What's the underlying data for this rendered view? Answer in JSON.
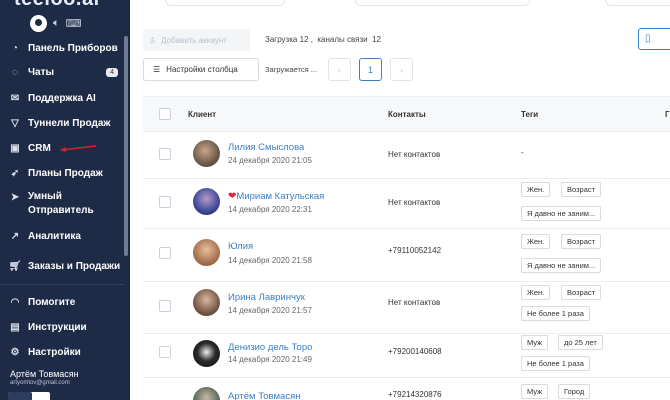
{
  "app": {
    "logo": "teeloo.ai"
  },
  "sidebar": {
    "items": [
      {
        "label": "Панель Приборов",
        "icon": "gauge-icon"
      },
      {
        "label": "Чаты",
        "icon": "chat-icon",
        "badge": "4"
      },
      {
        "label": "Поддержка AI",
        "icon": "mail-icon"
      },
      {
        "label": "Туннели Продаж",
        "icon": "filter-icon"
      },
      {
        "label": "CRM",
        "icon": "contacts-icon"
      },
      {
        "label": "Планы Продаж",
        "icon": "rocket-icon"
      },
      {
        "label": "Умный Отправитель",
        "icon": "paper-plane-icon"
      },
      {
        "label": "Аналитика",
        "icon": "chart-icon"
      },
      {
        "label": "Заказы и Продажи",
        "icon": "cart-icon"
      }
    ],
    "bottom_items": [
      {
        "label": "Помогите",
        "icon": "help-icon"
      },
      {
        "label": "Инструкции",
        "icon": "document-icon"
      },
      {
        "label": "Настройки",
        "icon": "gear-icon"
      }
    ],
    "user": {
      "name": "Артём Товмасян",
      "email": "artyomtov@gmail.com"
    }
  },
  "toolbar": {
    "add_account": "Добавить аккаунт",
    "load_status": "Загрузка 12 ,  каналы связи  12",
    "column_settings": "Настройки столбца",
    "loading": "Загружается ...",
    "page": "1",
    "prev": "‹",
    "next": "›"
  },
  "table": {
    "headers": {
      "client": "Клиент",
      "contacts": "Контакты",
      "tags": "Теги",
      "extra": "Г"
    },
    "rows": [
      {
        "name": "Лилия Смыслова",
        "date": "24 декабря 2020 21:05",
        "contact": "Нет контактов",
        "tags": [],
        "no_tags": "-"
      },
      {
        "name": "Мириам Катульская",
        "date": "14 декабря 2020 22:31",
        "contact": "Нет контактов",
        "tags": [
          "Жен.",
          "Возраст",
          "Я давно не заним..."
        ],
        "heart": "❤"
      },
      {
        "name": "Юлия",
        "date": "14 декабря 2020 21:58",
        "contact": "+79110052142",
        "tags": [
          "Жен.",
          "Возраст",
          "Я давно не заним..."
        ]
      },
      {
        "name": "Ирина Лавринчук",
        "date": "14 декабря 2020 21:57",
        "contact": "Нет контактов",
        "tags": [
          "Жен.",
          "Возраст",
          "Не более 1 раза"
        ]
      },
      {
        "name": "Денизио дель Торо",
        "date": "14 декабря 2020 21:49",
        "contact": "+79200140608",
        "tags": [
          "Муж",
          "до 25 лет",
          "Не более 1 раза"
        ]
      },
      {
        "name": "Артём Товмасян",
        "date": "14 декабря 2020 21:43",
        "contact": "+79214320876",
        "tags": [
          "Муж",
          "Город"
        ]
      }
    ]
  },
  "colors": {
    "sidebar_bg": "#1e2b47",
    "accent": "#3b82c4",
    "link": "#3b7fc4"
  }
}
